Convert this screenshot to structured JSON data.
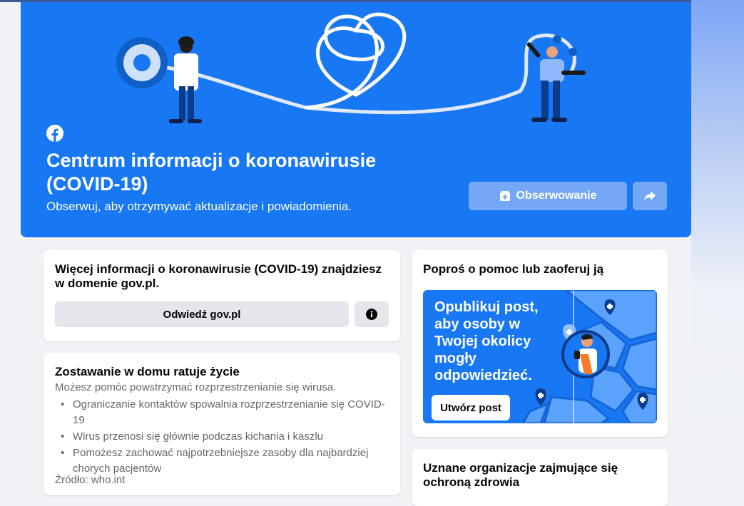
{
  "hero": {
    "title": "Centrum informacji o koronawirusie (COVID-19)",
    "subtitle": "Obserwuj, aby otrzymywać aktualizacje i powiadomienia.",
    "follow_label": "Obserwowanie",
    "colors": {
      "background": "#1877f2",
      "button": "#74a7f5"
    }
  },
  "info_card": {
    "title": "Więcej informacji o koronawirusie (COVID-19) znajdziesz w domenie gov.pl.",
    "visit_label": "Odwiedź gov.pl"
  },
  "stay_home_card": {
    "title": "Zostawanie w domu ratuje życie",
    "subtitle": "Możesz pomóc powstrzymać rozprzestrzenianie się wirusa.",
    "bullets": [
      "Ograniczanie kontaktów spowalnia rozprzestrzenianie się COVID-19",
      "Wirus przenosi się głównie podczas kichania i kaszlu",
      "Pomożesz zachować najpotrzebniejsze zasoby dla najbardziej chorych pacjentów"
    ],
    "source": "Źródło: who.int"
  },
  "help_card": {
    "title": "Poproś o pomoc lub zaoferuj ją",
    "promo_text": "Opublikuj post, aby osoby w Twojej okolicy mogły odpowiedzieć.",
    "create_post_label": "Utwórz post"
  },
  "orgs_card": {
    "title": "Uznane organizacje zajmujące się ochroną zdrowia"
  }
}
